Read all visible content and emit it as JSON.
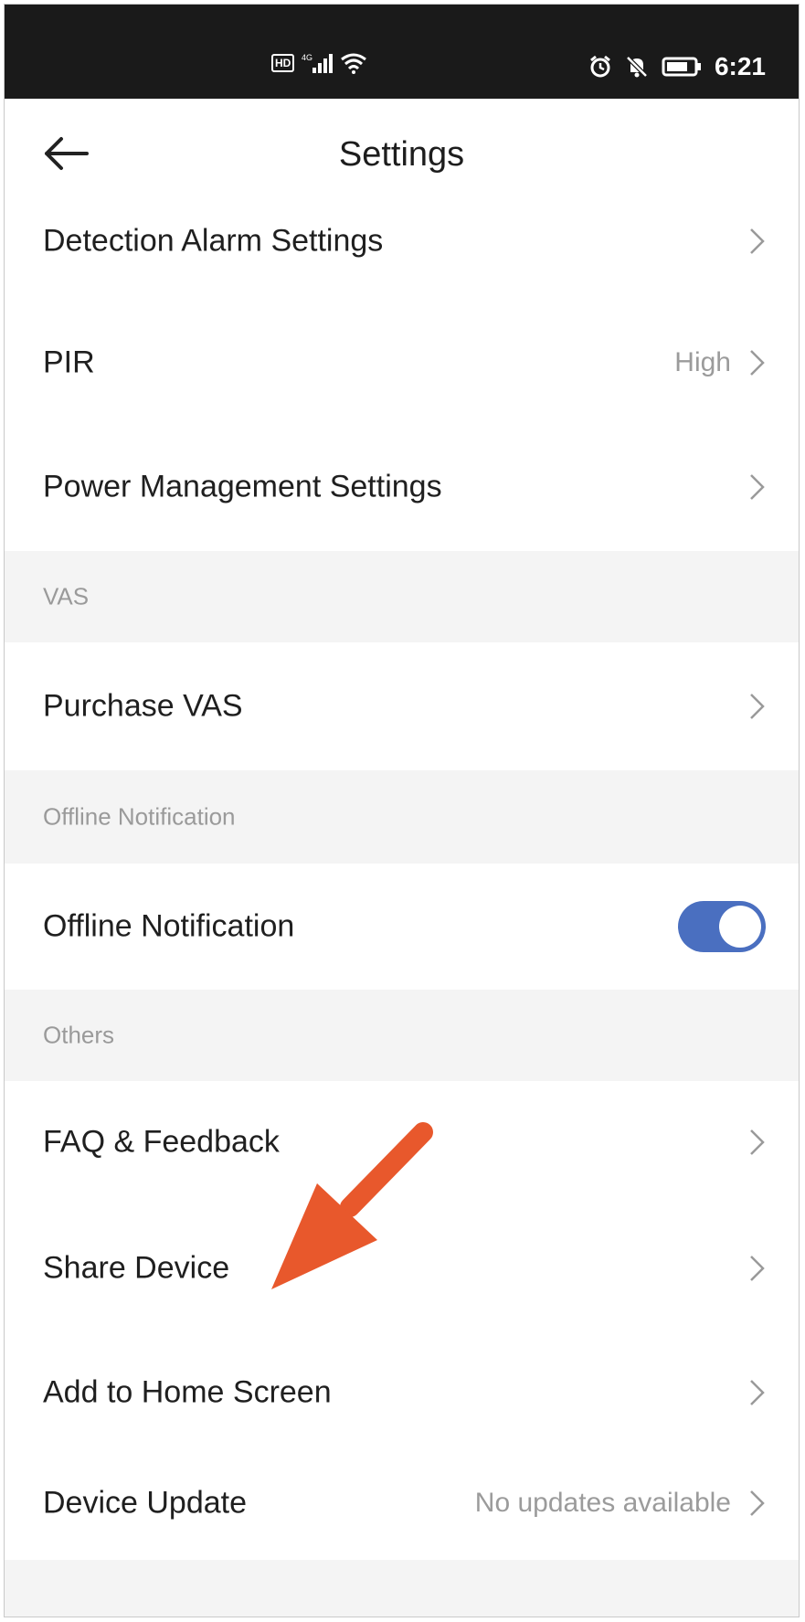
{
  "status_bar": {
    "network_badge": "HD",
    "signal_badge": "4G",
    "time": "6:21",
    "icons": [
      "hd-icon",
      "signal-icon",
      "wifi-icon",
      "alarm-icon",
      "mute-icon",
      "battery-icon"
    ]
  },
  "header": {
    "title": "Settings",
    "back_icon": "back-arrow-icon"
  },
  "rows": {
    "detection_alarm": {
      "label": "Detection Alarm Settings"
    },
    "pir": {
      "label": "PIR",
      "value": "High"
    },
    "power_management": {
      "label": "Power Management Settings"
    },
    "purchase_vas": {
      "label": "Purchase VAS"
    },
    "offline_notification": {
      "label": "Offline Notification",
      "enabled": true
    },
    "faq_feedback": {
      "label": "FAQ & Feedback"
    },
    "share_device": {
      "label": "Share Device"
    },
    "add_home_screen": {
      "label": "Add to Home Screen"
    },
    "device_update": {
      "label": "Device Update",
      "value": "No updates available"
    }
  },
  "sections": {
    "vas": "VAS",
    "offline": "Offline Notification",
    "others": "Others"
  },
  "colors": {
    "toggle_on": "#4a6fc0",
    "annotation_arrow": "#e8582c",
    "status_bar_bg": "#1a1a1a",
    "section_bg": "#f4f4f4"
  }
}
